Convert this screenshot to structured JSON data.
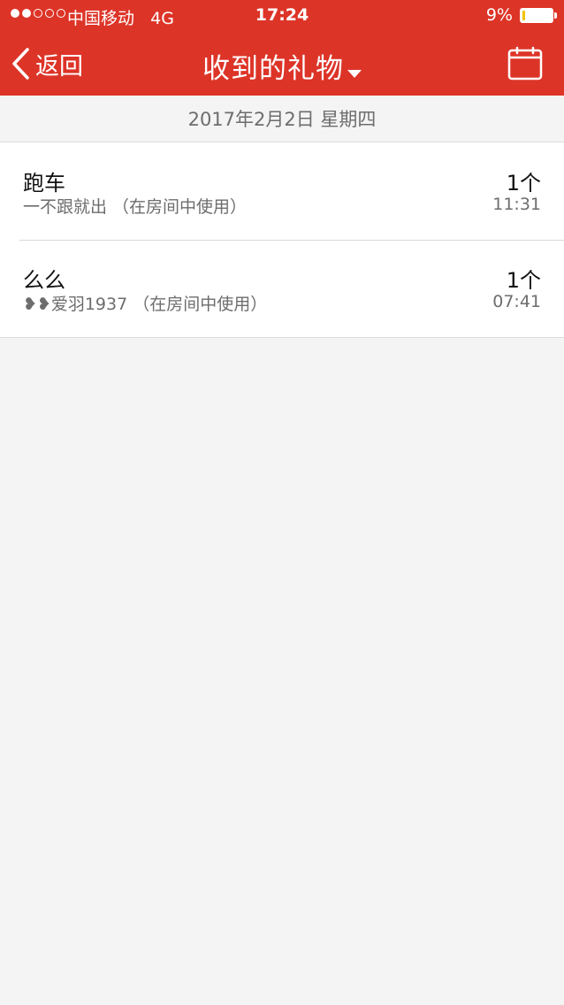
{
  "status_bar": {
    "carrier": "中国移动",
    "network": "4G",
    "time": "17:24",
    "battery_percent": "9%",
    "signal_bars": 2,
    "signal_total": 5
  },
  "nav": {
    "back_label": "返回",
    "title": "收到的礼物",
    "back_icon": "chevron-left-icon",
    "title_icon": "caret-down-icon",
    "action_icon": "calendar-icon"
  },
  "date_header": "2017年2月2日 星期四",
  "gifts": [
    {
      "name": "跑车",
      "sender": "一不跟就出 （在房间中使用）",
      "count": "1个",
      "time": "11:31"
    },
    {
      "name": "么么",
      "sender": "❥❥爱羽1937 （在房间中使用）",
      "count": "1个",
      "time": "07:41"
    }
  ],
  "colors": {
    "header_bg": "#dd3428",
    "page_bg": "#f4f4f4",
    "battery_low": "#f2c200"
  }
}
